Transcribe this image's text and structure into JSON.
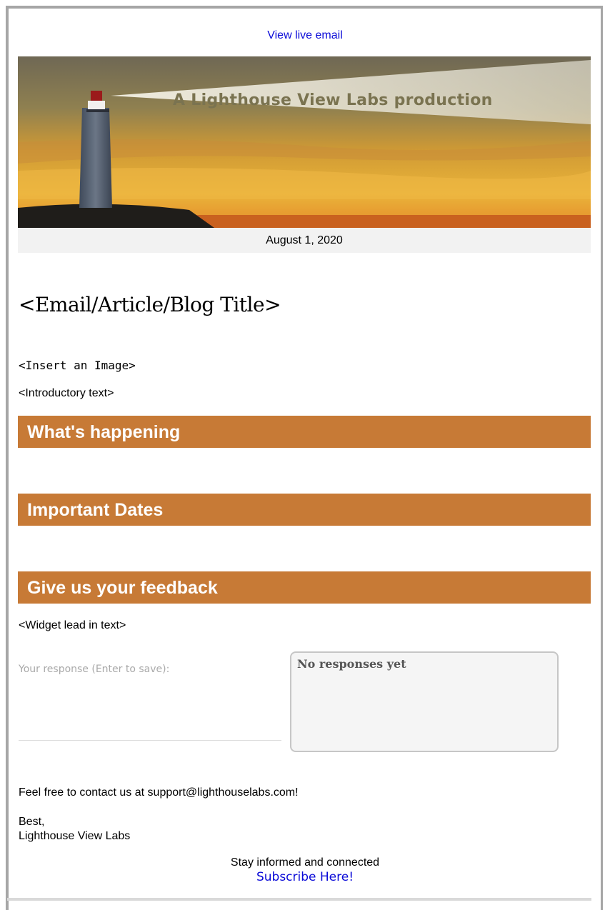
{
  "header": {
    "view_live_label": "View live email"
  },
  "banner": {
    "caption": "A Lighthouse View Labs production",
    "date": "August 1, 2020"
  },
  "article": {
    "title": "<Email/Article/Blog Title>",
    "image_placeholder": "<Insert an Image>",
    "intro": "<Introductory text>"
  },
  "sections": {
    "whats_happening": "What's happening",
    "important_dates": "Important Dates",
    "feedback": "Give us your feedback"
  },
  "widget": {
    "lead_in": "<Widget lead in text>",
    "response_label": "Your response (Enter to save):",
    "responses_text": "No responses yet"
  },
  "footer": {
    "contact": "Feel free to contact us at support@lighthouselabs.com!",
    "signoff_line1": "Best,",
    "signoff_line2": "Lighthouse View Labs",
    "stay_informed": "Stay informed and connected",
    "subscribe_label": "Subscribe Here!"
  },
  "colors": {
    "section_bar": "#c77a36",
    "link": "#0b0bd8"
  }
}
